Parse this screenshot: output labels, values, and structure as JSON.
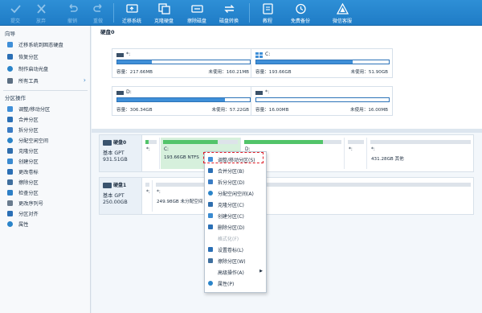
{
  "toolbar": {
    "items": [
      {
        "label": "提交",
        "icon": "check-icon",
        "disabled": true
      },
      {
        "label": "放弃",
        "icon": "x-icon",
        "disabled": true
      },
      {
        "label": "撤销",
        "icon": "undo-icon",
        "disabled": true
      },
      {
        "label": "重做",
        "icon": "redo-icon",
        "disabled": true
      },
      {
        "label": "迁移系统",
        "icon": "migrate-os-icon",
        "disabled": false
      },
      {
        "label": "克隆硬盘",
        "icon": "clone-disk-icon",
        "disabled": false
      },
      {
        "label": "擦除磁盘",
        "icon": "wipe-disk-icon",
        "disabled": false
      },
      {
        "label": "磁盘转换",
        "icon": "convert-disk-icon",
        "disabled": false
      },
      {
        "label": "教程",
        "icon": "tutorial-icon",
        "disabled": false
      },
      {
        "label": "免费备份",
        "icon": "backup-icon",
        "disabled": false
      },
      {
        "label": "微信客服",
        "icon": "wechat-service-icon",
        "disabled": false
      }
    ]
  },
  "sidebar": {
    "wizard_title": "向导",
    "wizard_items": [
      {
        "label": "迁移系统到固态硬盘",
        "icon": "migrate-icon"
      },
      {
        "label": "恢复分区",
        "icon": "restore-icon"
      },
      {
        "label": "制作启动光盘",
        "icon": "bootdisk-icon"
      },
      {
        "label": "所有工具",
        "icon": "tools-icon",
        "chevron": "›"
      }
    ],
    "ops_title": "分区操作",
    "ops_items": [
      {
        "label": "调整/移动分区",
        "icon": "resize-icon"
      },
      {
        "label": "合并分区",
        "icon": "merge-icon"
      },
      {
        "label": "拆分分区",
        "icon": "split-icon"
      },
      {
        "label": "分配空闲空间",
        "icon": "allocate-icon"
      },
      {
        "label": "克隆分区",
        "icon": "clone-icon"
      },
      {
        "label": "创建分区",
        "icon": "create-icon"
      },
      {
        "label": "更改卷标",
        "icon": "label-icon"
      },
      {
        "label": "擦除分区",
        "icon": "wipe-icon"
      },
      {
        "label": "检查分区",
        "icon": "check-partition-icon"
      },
      {
        "label": "更改序列号",
        "icon": "serial-icon"
      },
      {
        "label": "分区对齐",
        "icon": "align-icon"
      },
      {
        "label": "属性",
        "icon": "properties-icon"
      }
    ]
  },
  "disk0": {
    "title": "硬盘0",
    "partitions": [
      {
        "name": "*:",
        "capacity": "容量：217.66MB",
        "free": "未使用：160.21MB",
        "used_fraction": 0.26,
        "icon": "drive-icon"
      },
      {
        "name": "C:",
        "capacity": "容量：193.66GB",
        "free": "未使用：51.90GB",
        "used_fraction": 0.73,
        "icon": "windows-drive-icon"
      },
      {
        "name": "D:",
        "capacity": "容量：306.34GB",
        "free": "未使用：57.22GB",
        "used_fraction": 0.81,
        "icon": "drive-icon"
      },
      {
        "name": "*:",
        "capacity": "容量：16.00MB",
        "free": "未使用：16.00MB",
        "used_fraction": 0.0,
        "icon": "drive-icon"
      }
    ]
  },
  "map": {
    "disks": [
      {
        "name": "硬盘0",
        "type": "基本 GPT",
        "size": "931.51GB",
        "partitions": [
          {
            "label": "*:",
            "size": "",
            "used_fraction": 0.3,
            "selected": false
          },
          {
            "label": "C:",
            "size": "193.66GB NTFS",
            "used_fraction": 0.73,
            "selected": true
          },
          {
            "label": "D:",
            "size": "",
            "used_fraction": 0.81,
            "selected": false
          },
          {
            "label": "*:",
            "size": "",
            "used_fraction": 0.0,
            "selected": false
          },
          {
            "label": "*:",
            "size": "431.28GB 其他",
            "used_fraction": 0.0,
            "selected": false
          }
        ]
      },
      {
        "name": "硬盘1",
        "type": "基本 GPT",
        "size": "250.00GB",
        "partitions": [
          {
            "label": "*:",
            "size": "",
            "used_fraction": 0.0,
            "selected": false
          },
          {
            "label": "*:",
            "size": "249.98GB 未分配空间",
            "used_fraction": 0.0,
            "selected": false
          }
        ]
      }
    ]
  },
  "context_menu": {
    "items": [
      {
        "label": "调整/移动分区(S)",
        "icon": "resize-icon",
        "disabled": false,
        "submenu": false
      },
      {
        "label": "合并分区(B)",
        "icon": "merge-icon",
        "disabled": false,
        "submenu": false
      },
      {
        "label": "拆分分区(D)",
        "icon": "split-icon",
        "disabled": false,
        "submenu": false
      },
      {
        "label": "分配空闲空间(A)",
        "icon": "allocate-icon",
        "disabled": false,
        "submenu": false
      },
      {
        "label": "克隆分区(C)",
        "icon": "clone-icon",
        "disabled": false,
        "submenu": false
      },
      {
        "label": "创建分区(C)",
        "icon": "create-icon",
        "disabled": false,
        "submenu": false
      },
      {
        "label": "删除分区(D)",
        "icon": "delete-icon",
        "disabled": false,
        "submenu": false
      },
      {
        "label": "格式化(F)",
        "icon": "",
        "disabled": true,
        "submenu": false
      },
      {
        "label": "设置卷标(L)",
        "icon": "label-icon",
        "disabled": false,
        "submenu": false
      },
      {
        "label": "擦除分区(W)",
        "icon": "wipe-icon",
        "disabled": false,
        "submenu": false
      },
      {
        "label": "高级操作(A)",
        "icon": "",
        "disabled": false,
        "submenu": true
      },
      {
        "label": "属性(P)",
        "icon": "properties-icon",
        "disabled": false,
        "submenu": false
      }
    ]
  },
  "colors": {
    "toolbar_bg": "#2e8fd6",
    "accent_blue": "#3f8fd8",
    "partition_green": "#52c46a",
    "highlight_red": "#e0202a"
  }
}
